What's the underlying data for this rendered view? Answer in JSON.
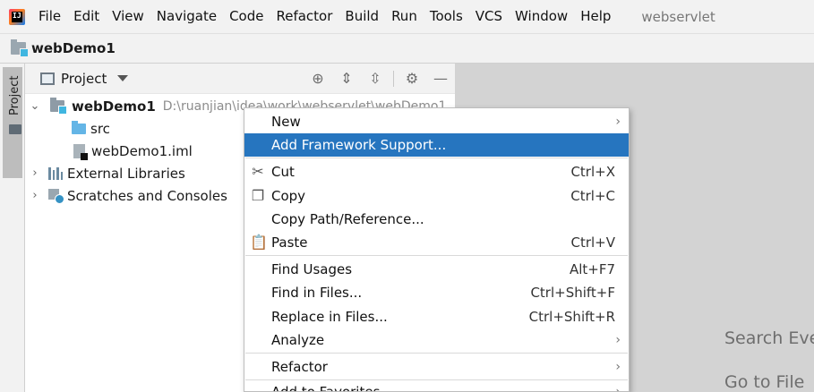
{
  "menubar": {
    "items": [
      "File",
      "Edit",
      "View",
      "Navigate",
      "Code",
      "Refactor",
      "Build",
      "Run",
      "Tools",
      "VCS",
      "Window",
      "Help"
    ],
    "window_title": "webservlet"
  },
  "navbar": {
    "title": "webDemo1"
  },
  "stripe": {
    "label": "Project"
  },
  "tool": {
    "label": "Project"
  },
  "tree": {
    "root_label": "webDemo1",
    "root_path": "D:\\ruanjian\\idea\\work\\webservlet\\webDemo1",
    "src_label": "src",
    "iml_label": "webDemo1.iml",
    "libs_label": "External Libraries",
    "scratch_label": "Scratches and Consoles"
  },
  "editor": {
    "hint1": "Search Eve",
    "hint2": "Go to File"
  },
  "context_menu": {
    "new": "New",
    "add_framework": "Add Framework Support...",
    "cut": "Cut",
    "cut_sc": "Ctrl+X",
    "copy": "Copy",
    "copy_sc": "Ctrl+C",
    "copy_path": "Copy Path/Reference...",
    "paste": "Paste",
    "paste_sc": "Ctrl+V",
    "find_usages": "Find Usages",
    "find_usages_sc": "Alt+F7",
    "find_in_files": "Find in Files...",
    "find_in_files_sc": "Ctrl+Shift+F",
    "replace_in_files": "Replace in Files...",
    "replace_in_files_sc": "Ctrl+Shift+R",
    "analyze": "Analyze",
    "refactor": "Refactor",
    "add_to_favorites": "Add to Favorites"
  },
  "colors": {
    "selection": "#2675bf",
    "editor_bg": "#d3d3d3",
    "panel_bg": "#f2f2f2"
  }
}
